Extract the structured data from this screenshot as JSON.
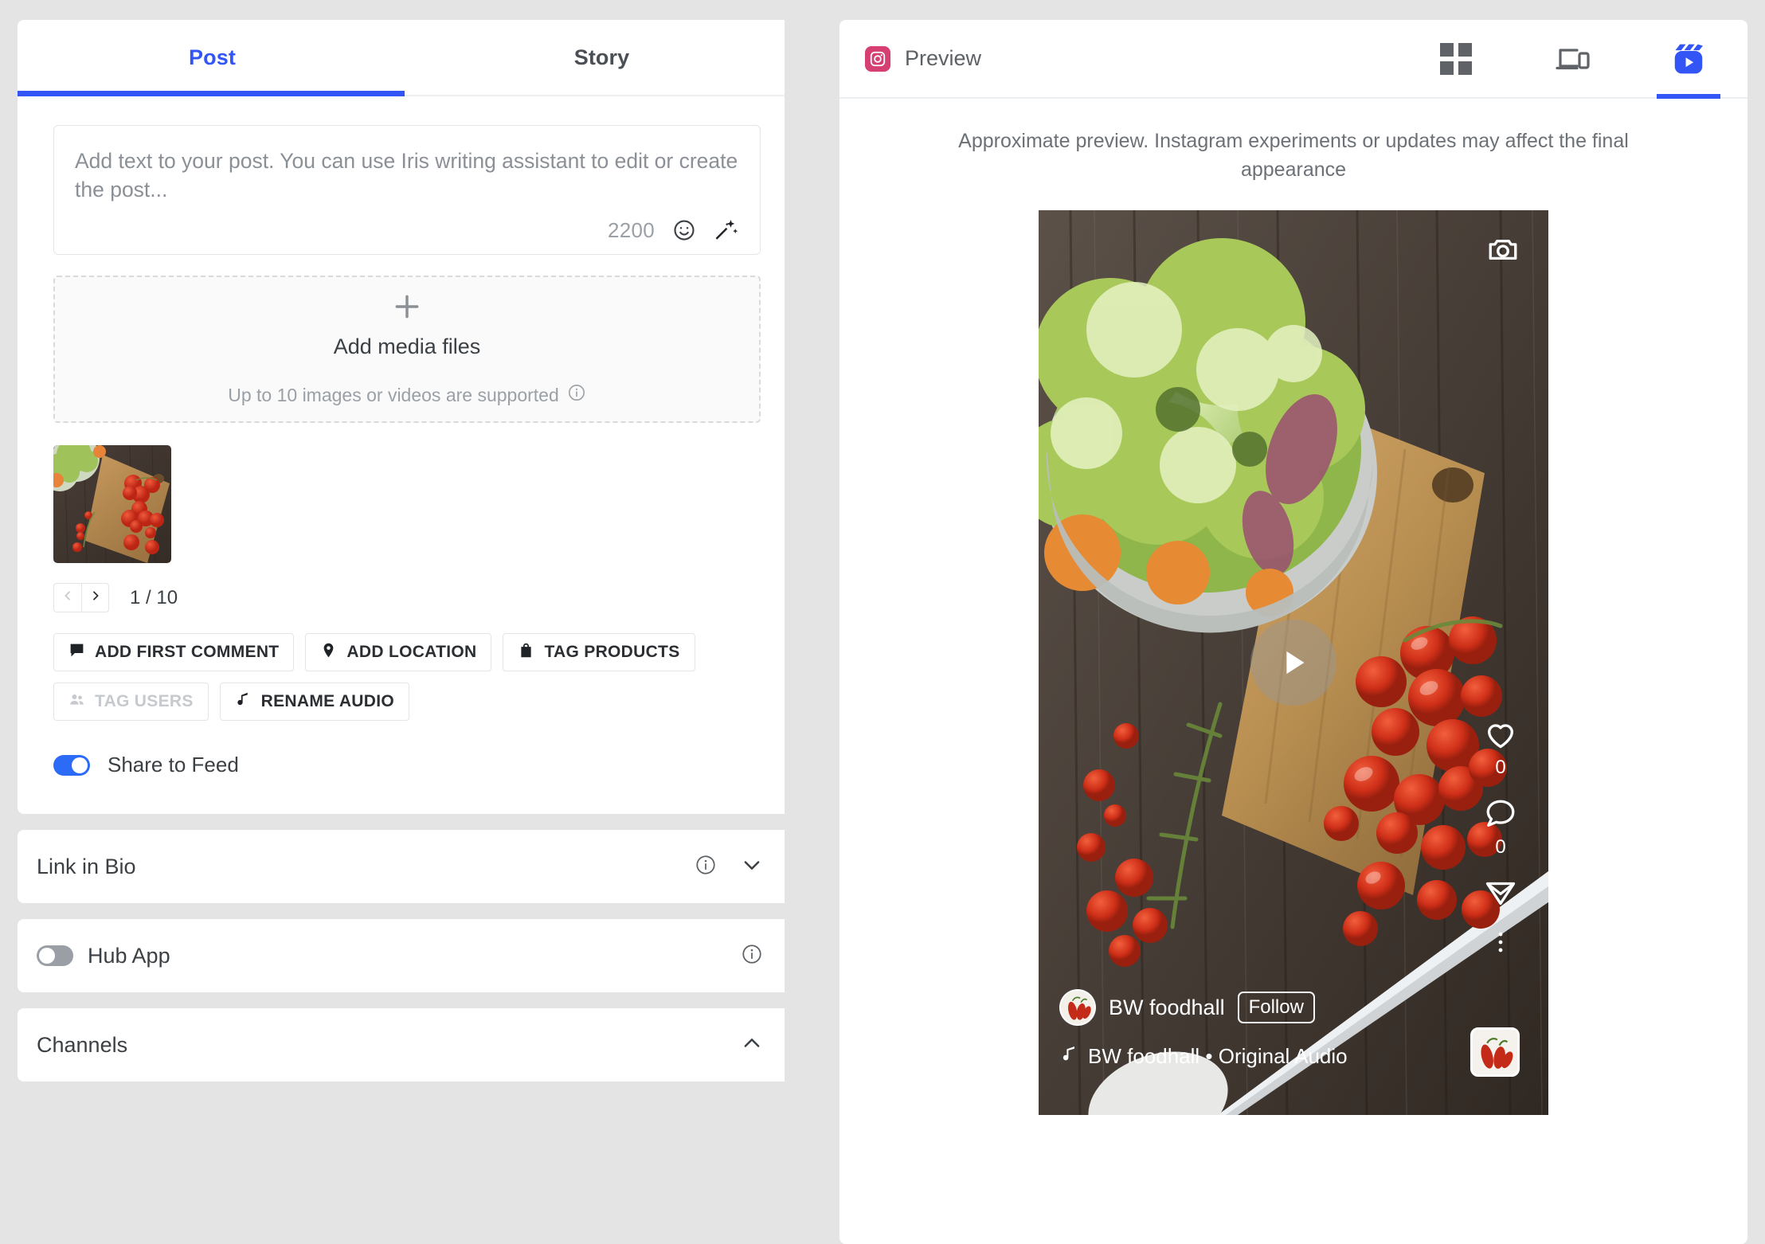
{
  "editor": {
    "tabs": [
      {
        "label": "Post",
        "active": true
      },
      {
        "label": "Story",
        "active": false
      }
    ],
    "composer": {
      "placeholder": "Add text to your post. You can use Iris writing assistant to edit or create the post...",
      "value": "",
      "char_count": "2200",
      "emoji_icon": "smiley-icon",
      "ai_icon": "magic-wand-sparkles-icon"
    },
    "dropzone": {
      "plus_icon": "plus-icon",
      "title": "Add media files",
      "subtitle": "Up to 10 images or videos are supported",
      "info_icon": "info-icon"
    },
    "carousel": {
      "prev_icon": "chevron-left-icon",
      "next_icon": "chevron-right-icon",
      "counter": "1 / 10",
      "thumbnail_alt": "salad bowl and cherry tomatoes on cutting board"
    },
    "actions_row_1": [
      {
        "label": "ADD FIRST COMMENT",
        "icon": "comment-icon",
        "disabled": false
      },
      {
        "label": "ADD LOCATION",
        "icon": "location-pin-icon",
        "disabled": false
      },
      {
        "label": "TAG PRODUCTS",
        "icon": "shopping-bag-icon",
        "disabled": false
      }
    ],
    "actions_row_2": [
      {
        "label": "TAG USERS",
        "icon": "users-icon",
        "disabled": true
      },
      {
        "label": "RENAME AUDIO",
        "icon": "music-note-icon",
        "disabled": false
      }
    ],
    "share_to_feed": {
      "label": "Share to Feed",
      "enabled": true
    },
    "sections": [
      {
        "title": "Link in Bio",
        "info_icon": "info-icon",
        "chevron": "chevron-down-icon",
        "expanded": false,
        "has_toggle": false
      },
      {
        "title": "Hub App",
        "info_icon": "info-icon",
        "has_toggle": true,
        "toggle_enabled": false
      },
      {
        "title": "Channels",
        "chevron": "chevron-up-icon",
        "expanded": true,
        "has_toggle": false
      }
    ]
  },
  "preview": {
    "network_icon": "instagram-icon",
    "title": "Preview",
    "view_modes": [
      {
        "name": "grid-view-icon",
        "active": false
      },
      {
        "name": "device-view-icon",
        "active": false
      },
      {
        "name": "reels-view-icon",
        "active": true
      }
    ],
    "note": "Approximate preview. Instagram experiments or updates may affect the final appearance",
    "media": {
      "camera_icon": "camera-icon",
      "play_icon": "play-icon",
      "alt": "salad bowl and cherry tomatoes on a wooden cutting board"
    },
    "engagement": [
      {
        "icon": "heart-icon",
        "count": "0"
      },
      {
        "icon": "comment-bubble-icon",
        "count": "0"
      },
      {
        "icon": "share-paper-plane-icon",
        "count": ""
      },
      {
        "icon": "more-options-icon",
        "count": ""
      }
    ],
    "profile": {
      "name": "BW foodhall",
      "follow_label": "Follow",
      "avatar_alt": "red chili peppers"
    },
    "audio": {
      "music_icon": "music-note-icon",
      "label": "BW foodhall • Original Audio",
      "thumb_alt": "red chili peppers"
    }
  },
  "colors": {
    "accent_blue": "#3355f5",
    "toggle_on": "#2c6bf5",
    "instagram_pink": "#d53f71",
    "page_bg": "#e4e4e4"
  }
}
